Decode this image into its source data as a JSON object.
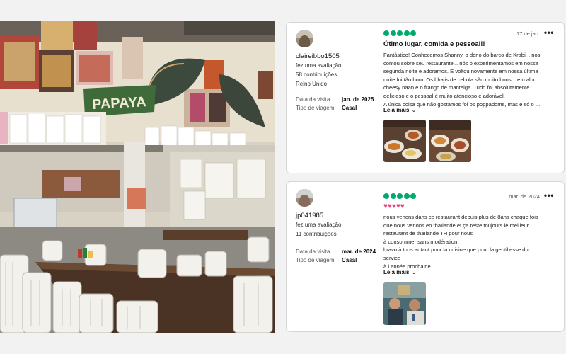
{
  "reviews": [
    {
      "username": "claireibbo1505",
      "action": "fez uma avaliação",
      "contributions": "58 contribuições",
      "location": "Reino Unido",
      "visit_label": "Data da visita",
      "visit_value": "jan. de 2025",
      "trip_label": "Tipo de viagem",
      "trip_value": "Casal",
      "rating": 5,
      "date": "17 de jan.",
      "title": "Ótimo lugar, comida e pessoal!!",
      "text_lines": [
        "Fantástico! Conhecemos Shanny, o dono do barco de Krabi. . nos",
        "contou sobre seu restaurante... nós o experimentamos em nossa",
        "segunda noite e adoramos. E voltou novamente em nossa última",
        "noite foi tão bom. Os bhajis de cebola são muito bons... e o alho",
        "cheesy naan e o frango de manteiga. Tudo foi absolutamente",
        "delicioso e o pessoal é muito atencioso e adorável.",
        "A única coisa que não gostamos foi os poppadoms, mas é só o ..."
      ],
      "read_more": "Leia mais",
      "more_icon": "more-horizontal-icon"
    },
    {
      "username": "jp041985",
      "action": "fez uma avaliação",
      "contributions": "11 contribuições",
      "visit_label": "Data da visita",
      "visit_value": "mar. de 2024",
      "trip_label": "Tipo de viagem",
      "trip_value": "Casal",
      "rating": 5,
      "date": "mar. de 2024",
      "hearts": "♥♥♥♥♥",
      "text_lines": [
        "nous venons dans ce restaurant depuis plus de 8ans chaque fois",
        "que nous venons en thaïlande et ça reste toujours le meilleur",
        "restaurant de thaïlande TH pour nous",
        "à consommer sans modération",
        "bravo à tous autant pour la cuisine que pour la gentillesse du",
        "service",
        "à l année prochaine ..."
      ],
      "read_more": "Leia mais"
    }
  ],
  "photo": {
    "sign_text": "PAPAYA"
  },
  "colors": {
    "rating_green": "#00aa6c",
    "heart_pink": "#e0457b"
  }
}
